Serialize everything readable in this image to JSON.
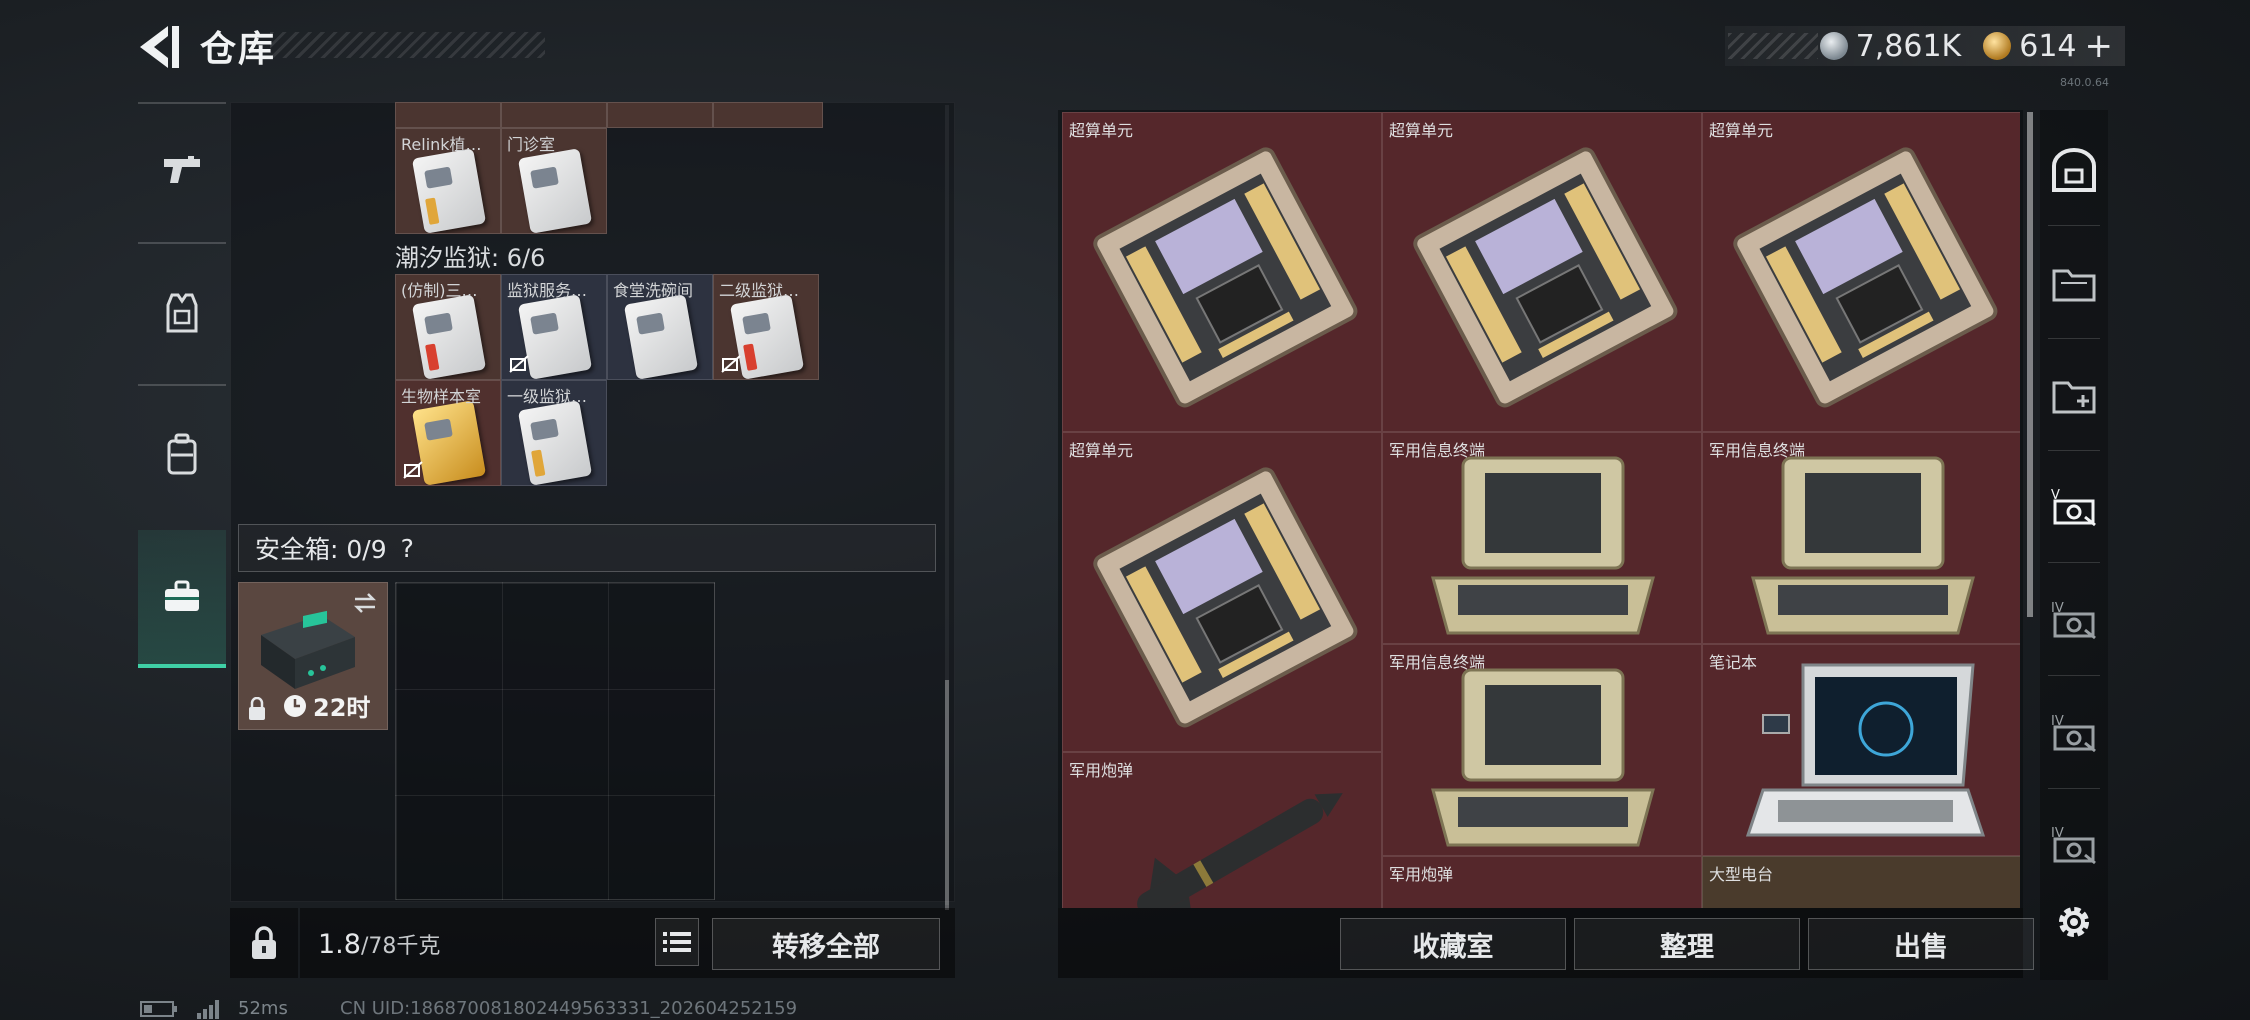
{
  "header": {
    "title": "仓库",
    "currency": [
      {
        "icon": "silver-coin-icon",
        "value": "7,861K"
      },
      {
        "icon": "gold-coin-icon",
        "value": "614"
      }
    ],
    "add_label": "+",
    "version": "840.0.64"
  },
  "left_tabs": [
    {
      "name": "weapons",
      "icon": "pistol-icon"
    },
    {
      "name": "armor",
      "icon": "vest-icon"
    },
    {
      "name": "backpack",
      "icon": "backpack-icon"
    },
    {
      "name": "case",
      "icon": "briefcase-icon",
      "active": true
    }
  ],
  "keycards_top": [
    {
      "label": "Relink植…",
      "style": "gold"
    },
    {
      "label": "门诊室",
      "style": "plain"
    }
  ],
  "section": {
    "title": "潮汐监狱: 6/6"
  },
  "keycards": [
    {
      "label": "(仿制)三…",
      "style": "red",
      "bg": "brown",
      "noshare": false
    },
    {
      "label": "监狱服务…",
      "style": "plain",
      "bg": "navy",
      "noshare": true
    },
    {
      "label": "食堂洗碗间",
      "style": "plain",
      "bg": "navy",
      "noshare": false
    },
    {
      "label": "二级监狱…",
      "style": "red",
      "bg": "brown",
      "noshare": true
    },
    {
      "label": "生物样本室",
      "style": "goldfull",
      "bg": "maroon",
      "noshare": true
    },
    {
      "label": "一级监狱…",
      "style": "gold",
      "bg": "navy",
      "noshare": false
    }
  ],
  "safe": {
    "label": "安全箱: 0/9",
    "help": "?",
    "timer": "22时"
  },
  "bottom_left": {
    "weight": "1.8",
    "weight_max": "/78千克",
    "transfer_label": "转移全部"
  },
  "storage_items": [
    {
      "label": "超算单元",
      "type": "chip"
    },
    {
      "label": "超算单元",
      "type": "chip"
    },
    {
      "label": "超算单元",
      "type": "chip"
    },
    {
      "label": "超算单元",
      "type": "chip"
    },
    {
      "label": "军用信息终端",
      "type": "terminal"
    },
    {
      "label": "军用信息终端",
      "type": "terminal"
    },
    {
      "label": "军用信息终端",
      "type": "terminal"
    },
    {
      "label": "笔记本",
      "type": "laptop"
    },
    {
      "label": "军用炮弹",
      "type": "shell"
    },
    {
      "label": "军用炮弹",
      "type": "shell"
    },
    {
      "label": "大型电台",
      "type": "radio"
    }
  ],
  "bottom_right": {
    "collection_label": "收藏室",
    "sort_label": "整理",
    "sell_label": "出售"
  },
  "right_tabs": [
    {
      "icon": "vault-icon"
    },
    {
      "icon": "folder-icon"
    },
    {
      "icon": "folder-add-icon"
    },
    {
      "icon": "locker-v-icon",
      "tier": "V"
    },
    {
      "icon": "locker-iv-icon",
      "tier": "IV"
    },
    {
      "icon": "locker-iv-icon",
      "tier": "IV"
    },
    {
      "icon": "locker-iv-icon",
      "tier": "IV"
    },
    {
      "icon": "gear-icon"
    }
  ],
  "footer": {
    "ping": "52ms",
    "uid": "CN UID:1868700818024495633​31_202604252159"
  }
}
